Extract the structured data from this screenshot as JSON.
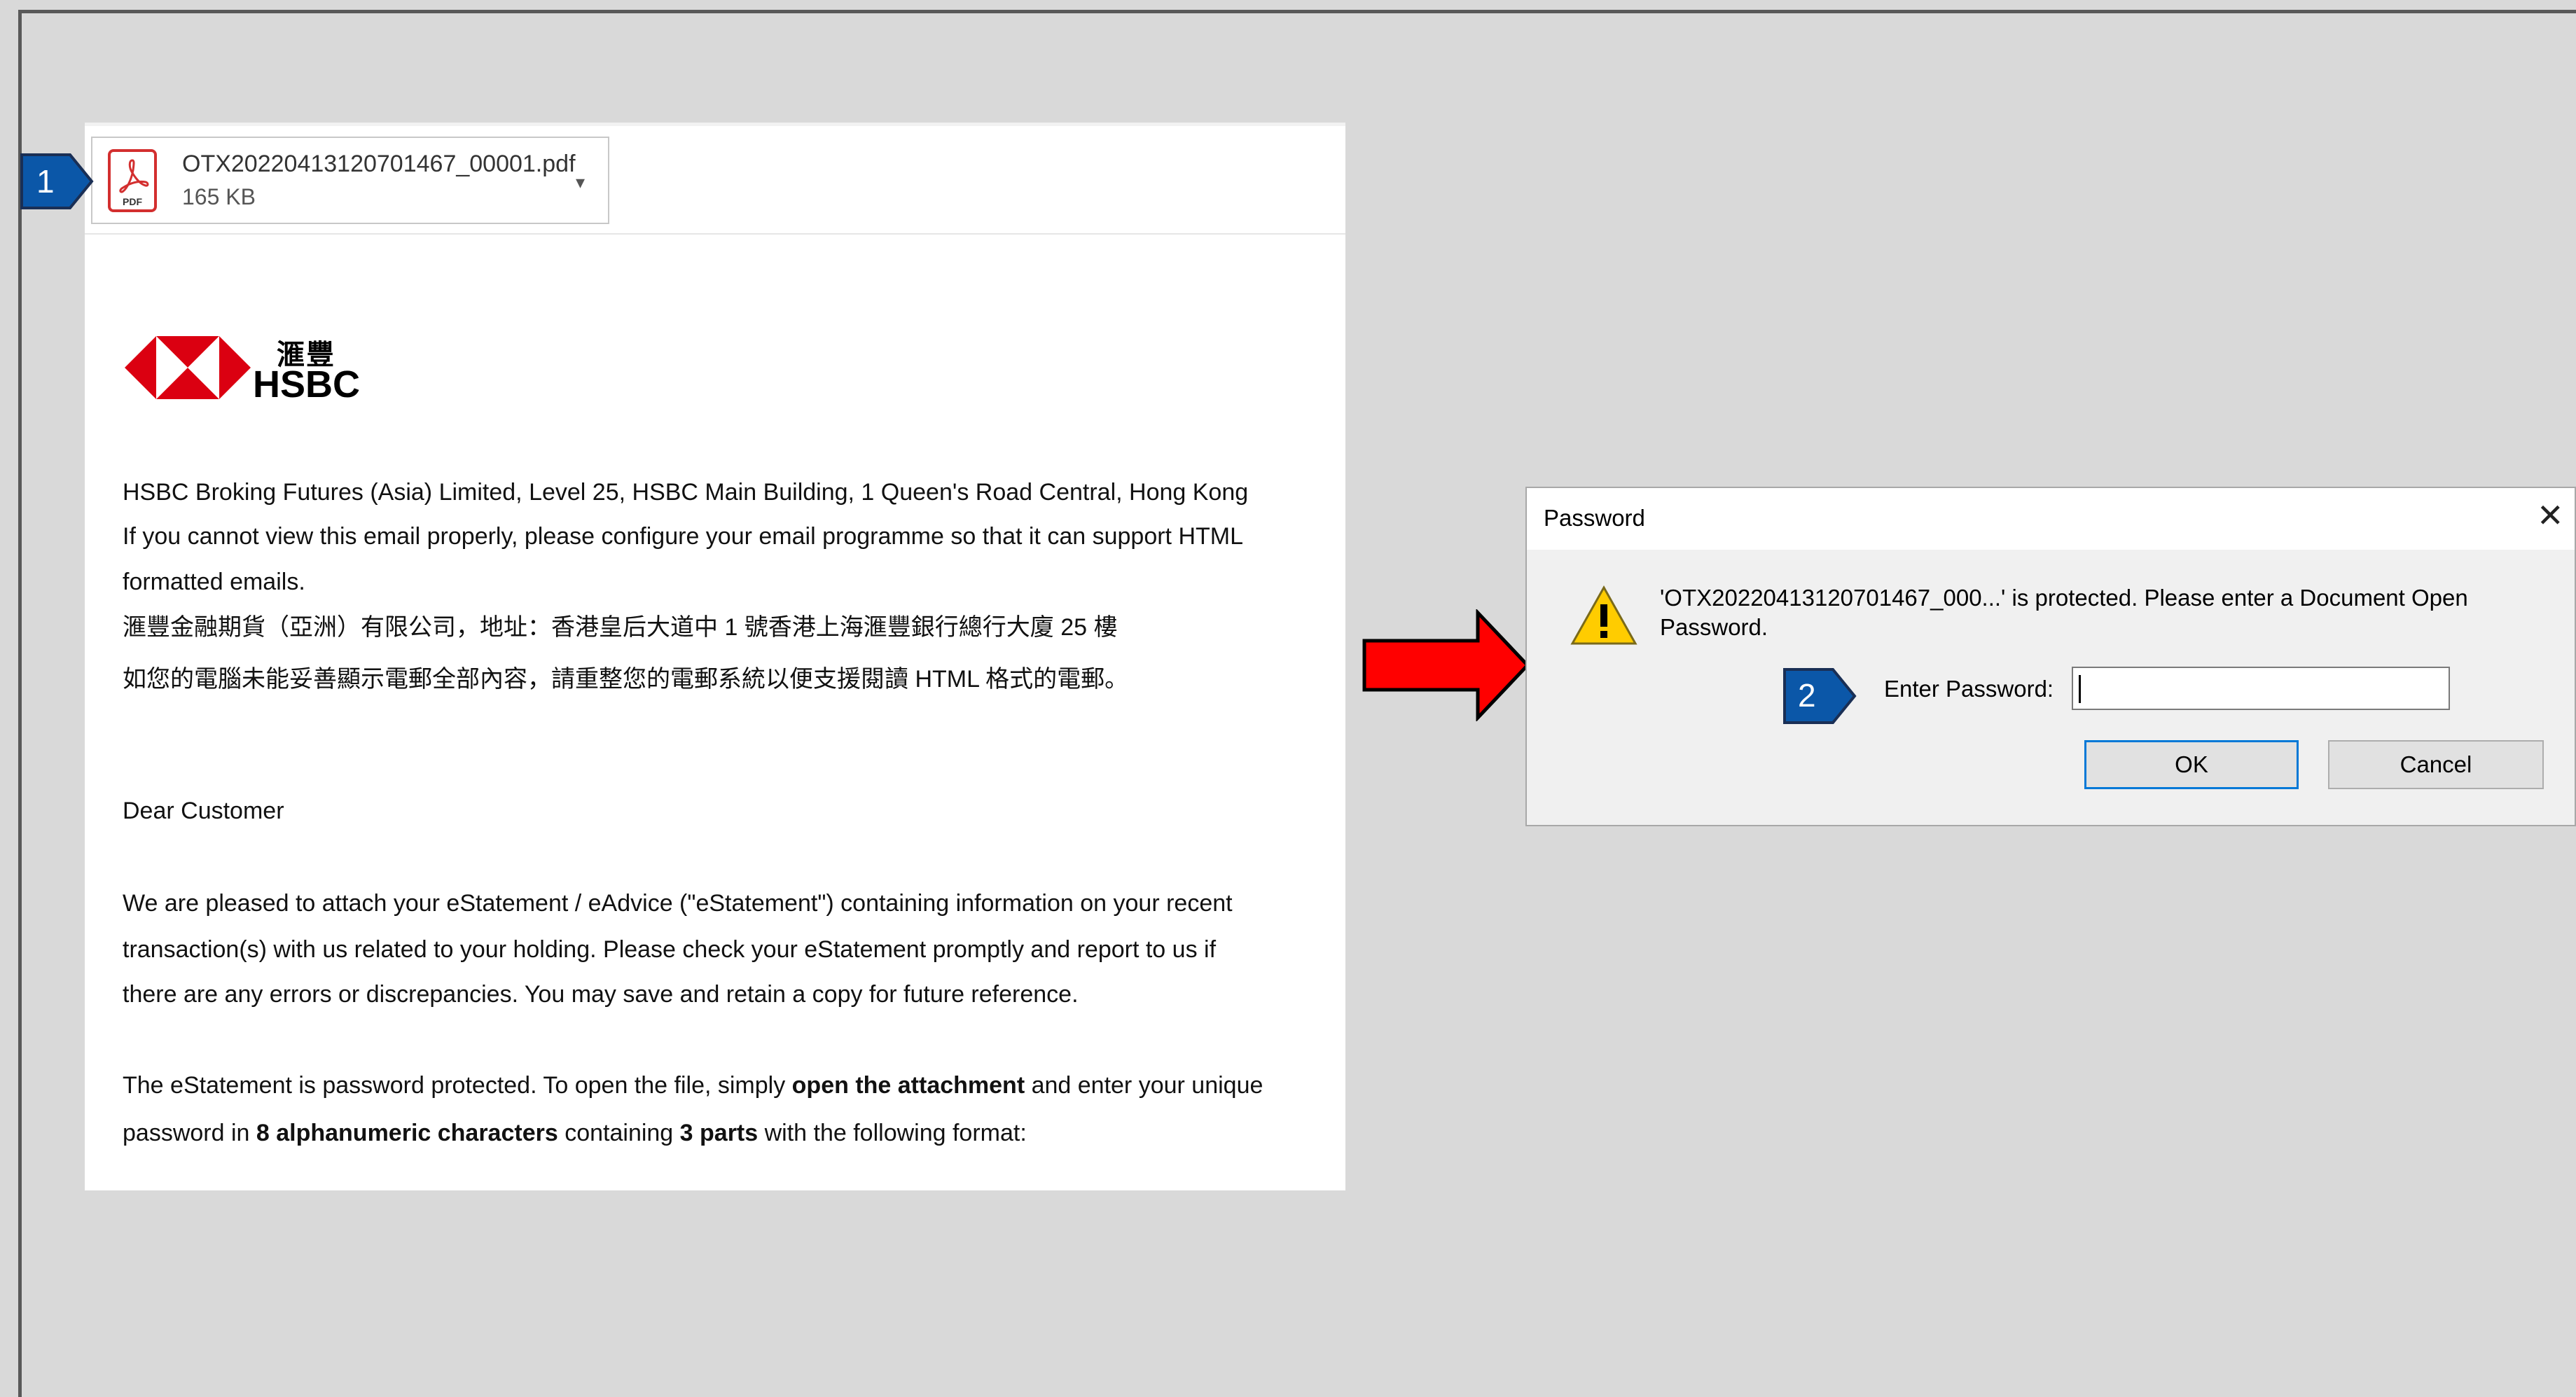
{
  "attachment": {
    "filename": "OTX20220413120701467_00001.pdf",
    "size": "165 KB",
    "icon": "pdf-file-icon",
    "dropdown_icon": "chevron-down-icon"
  },
  "badges": {
    "step1": "1",
    "step2": "2"
  },
  "logo": {
    "chinese": "滙豐",
    "english": "HSBC"
  },
  "email": {
    "address_line": "HSBC Broking Futures (Asia) Limited, Level 25, HSBC Main Building, 1 Queen's Road Central, Hong Kong",
    "view_line1": "If you cannot view this email properly, please configure your email programme so that it can support HTML",
    "view_line2": "formatted emails.",
    "zh_line1": "滙豐金融期貨（亞洲）有限公司，地址：香港皇后大道中 1 號香港上海滙豐銀行總行大廈 25 樓",
    "zh_line2": "如您的電腦未能妥善顯示電郵全部內容，請重整您的電郵系統以便支援閱讀 HTML 格式的電郵。",
    "greeting": "Dear Customer",
    "para1_line1": "We are pleased to attach your eStatement / eAdvice (\"eStatement\") containing information on your recent",
    "para1_line2": "transaction(s) with us related to your holding. Please check your eStatement promptly and report to us if",
    "para1_line3": "there are any errors or discrepancies. You may save and retain a copy for future reference.",
    "para2_l1_a": "The eStatement is password protected. To open the file, simply ",
    "para2_l1_b": "open the attachment",
    "para2_l1_c": " and enter your unique",
    "para2_l2_a": "password in ",
    "para2_l2_b": "8 alphanumeric characters",
    "para2_l2_c": " containing ",
    "para2_l2_d": "3 parts",
    "para2_l2_e": " with the following format:"
  },
  "dialog": {
    "title": "Password",
    "close_icon": "close-icon",
    "warning_icon": "warning-icon",
    "message_line1": "'OTX20220413120701467_000...' is protected. Please enter a Document Open",
    "message_line2": "Password.",
    "password_label": "Enter Password:",
    "password_value": "",
    "ok_label": "OK",
    "cancel_label": "Cancel"
  },
  "colors": {
    "background": "#d9d9d9",
    "badge_blue": "#0b57a8",
    "arrow_red": "#ff0000",
    "hsbc_red": "#db0011",
    "ok_border": "#0078d7"
  }
}
